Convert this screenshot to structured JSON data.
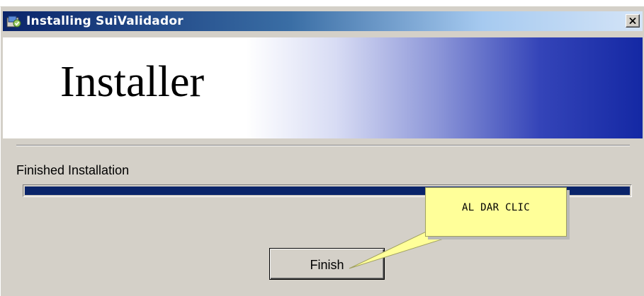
{
  "window": {
    "title": "Installing SuiValidador",
    "icon": "installer-app-icon",
    "close_icon": "close-icon"
  },
  "banner": {
    "title": "Installer"
  },
  "status": {
    "text": "Finished Installation"
  },
  "progress": {
    "percent": 100
  },
  "buttons": {
    "finish_label": "Finish"
  },
  "annotation": {
    "callout_text": "AL DAR CLIC"
  },
  "colors": {
    "titlebar_start": "#0a246a",
    "progress_fill": "#0a246a",
    "dialog_face": "#d4d0c8",
    "callout_fill": "#ffff99"
  }
}
